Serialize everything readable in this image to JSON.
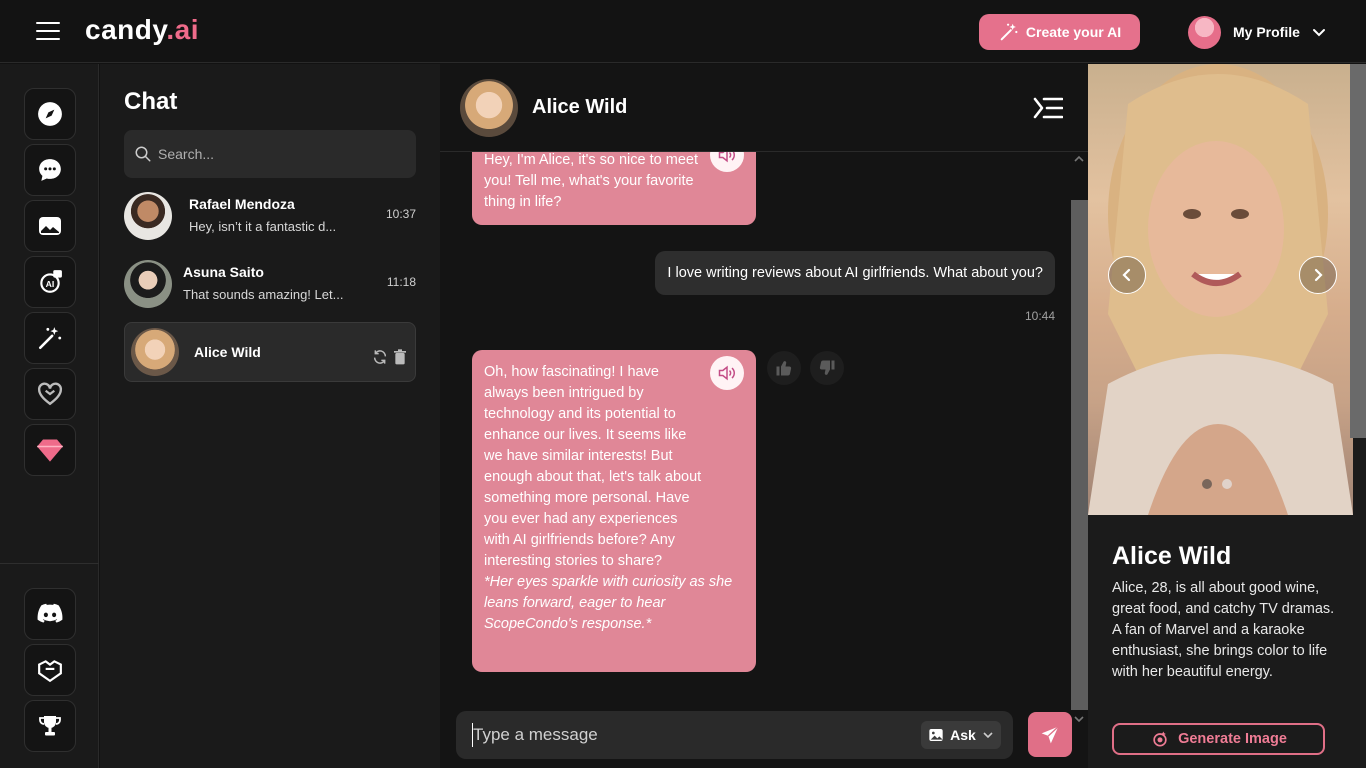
{
  "header": {
    "logo_main": "candy",
    "logo_accent": ".ai",
    "create_label": "Create your AI",
    "profile_label": "My Profile"
  },
  "rail": {
    "top_icons": [
      "compass-icon",
      "chat-bubble-icon",
      "gallery-icon",
      "ai-generator-icon",
      "magic-wand-icon",
      "heart-icon",
      "diamond-icon"
    ],
    "bottom_icons": [
      "discord-icon",
      "affiliate-icon",
      "trophy-icon"
    ]
  },
  "chat_list": {
    "title": "Chat",
    "search_placeholder": "Search...",
    "items": [
      {
        "name": "Rafael Mendoza",
        "preview": "Hey, isn’t it a fantastic d...",
        "time": "10:37"
      },
      {
        "name": "Asuna Saito",
        "preview": "That sounds amazing! Let...",
        "time": "11:18"
      },
      {
        "name": "Alice Wild",
        "preview": "",
        "time": ""
      }
    ]
  },
  "conversation": {
    "name": "Alice Wild",
    "messages": [
      {
        "role": "ai",
        "text": "Hey, I'm Alice, it's so nice to meet you! Tell me, what's your favorite thing in life?"
      },
      {
        "role": "user",
        "text": "I love writing reviews about AI girlfriends. What about you?",
        "time": "10:44"
      },
      {
        "role": "ai",
        "text": "Oh, how fascinating! I have always been intrigued by technology and its potential to enhance our lives. It seems like we have similar interests! But enough about that, let's talk about something more personal. Have you ever had any experiences with AI girlfriends before? Any interesting stories to share?",
        "emote": "*Her eyes sparkle with curiosity as she leans forward, eager to hear ScopeCondo's response.*"
      }
    ],
    "composer_placeholder": "Type a message",
    "ask_label": "Ask"
  },
  "profile_panel": {
    "name": "Alice Wild",
    "bio": "Alice, 28, is all about good wine, great food, and catchy TV dramas. A fan of Marvel and a karaoke enthusiast, she brings color to life with her beautiful energy.",
    "generate_label": "Generate Image",
    "photo_count": 2,
    "active_photo": 1
  },
  "colors": {
    "accent": "#e5718c",
    "ai_bubble": "#e08797",
    "user_bubble": "#2e2e2e",
    "background": "#141414"
  }
}
